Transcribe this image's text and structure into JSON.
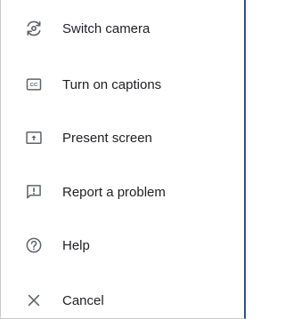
{
  "menu": {
    "items": [
      {
        "label": "Switch camera",
        "icon": "switch-camera-icon"
      },
      {
        "label": "Turn on captions",
        "icon": "captions-icon"
      },
      {
        "label": "Present screen",
        "icon": "present-screen-icon"
      },
      {
        "label": "Report a problem",
        "icon": "report-problem-icon"
      },
      {
        "label": "Help",
        "icon": "help-icon"
      },
      {
        "label": "Cancel",
        "icon": "close-icon"
      }
    ]
  },
  "colors": {
    "text": "#202124",
    "icon": "#5f6368",
    "frame_accent": "#2f4f83"
  }
}
